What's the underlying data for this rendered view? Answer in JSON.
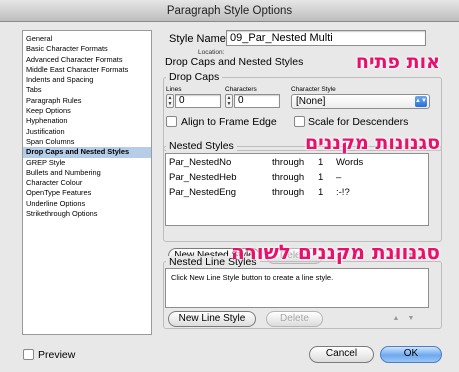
{
  "window": {
    "title": "Paragraph Style Options"
  },
  "sidebar": {
    "items": [
      "General",
      "Basic Character Formats",
      "Advanced Character Formats",
      "Middle East Character Formats",
      "Indents and Spacing",
      "Tabs",
      "Paragraph Rules",
      "Keep Options",
      "Hyphenation",
      "Justification",
      "Span Columns",
      "Drop Caps and Nested Styles",
      "GREP Style",
      "Bullets and Numbering",
      "Character Colour",
      "OpenType Features",
      "Underline Options",
      "Strikethrough Options"
    ],
    "selected_index": 11
  },
  "header": {
    "style_name_label": "Style Name:",
    "style_name_value": "09_Par_Nested Multi",
    "location_label": "Location:",
    "section_title": "Drop Caps and Nested Styles"
  },
  "drop_caps": {
    "title": "Drop Caps",
    "lines_label": "Lines",
    "lines_value": "0",
    "characters_label": "Characters",
    "characters_value": "0",
    "char_style_label": "Character Style",
    "char_style_value": "[None]",
    "align_label": "Align to Frame Edge",
    "scale_label": "Scale for Descenders",
    "align_checked": false,
    "scale_checked": false
  },
  "nested_styles": {
    "title": "Nested Styles",
    "rows": [
      {
        "style": "Par_NestedNo",
        "through": "through",
        "count": "1",
        "delimiter": "Words"
      },
      {
        "style": "Par_NestedHeb",
        "through": "through",
        "count": "1",
        "delimiter": "–"
      },
      {
        "style": "Par_NestedEng",
        "through": "through",
        "count": "1",
        "delimiter": ":-!?"
      }
    ],
    "new_button": "New Nested Style",
    "delete_button": "Delete",
    "up_icon": "▲",
    "down_icon": "▼"
  },
  "nested_line_styles": {
    "title": "Nested Line Styles",
    "hint": "Click New Line Style button to create a line style.",
    "new_button": "New Line Style",
    "delete_button": "Delete",
    "up_icon": "▲",
    "down_icon": "▼"
  },
  "annotations": {
    "drop_caps_heb": "אות פתיח",
    "nested_heb": "סגנונות מקננים",
    "line_heb": "סגנוונת מקננים לשורה"
  },
  "footer": {
    "preview_label": "Preview",
    "cancel_button": "Cancel",
    "ok_button": "OK"
  },
  "colors": {
    "accent": "#e8106a",
    "selection": "#b5cde8",
    "ok_button": "#6ea9ee"
  }
}
